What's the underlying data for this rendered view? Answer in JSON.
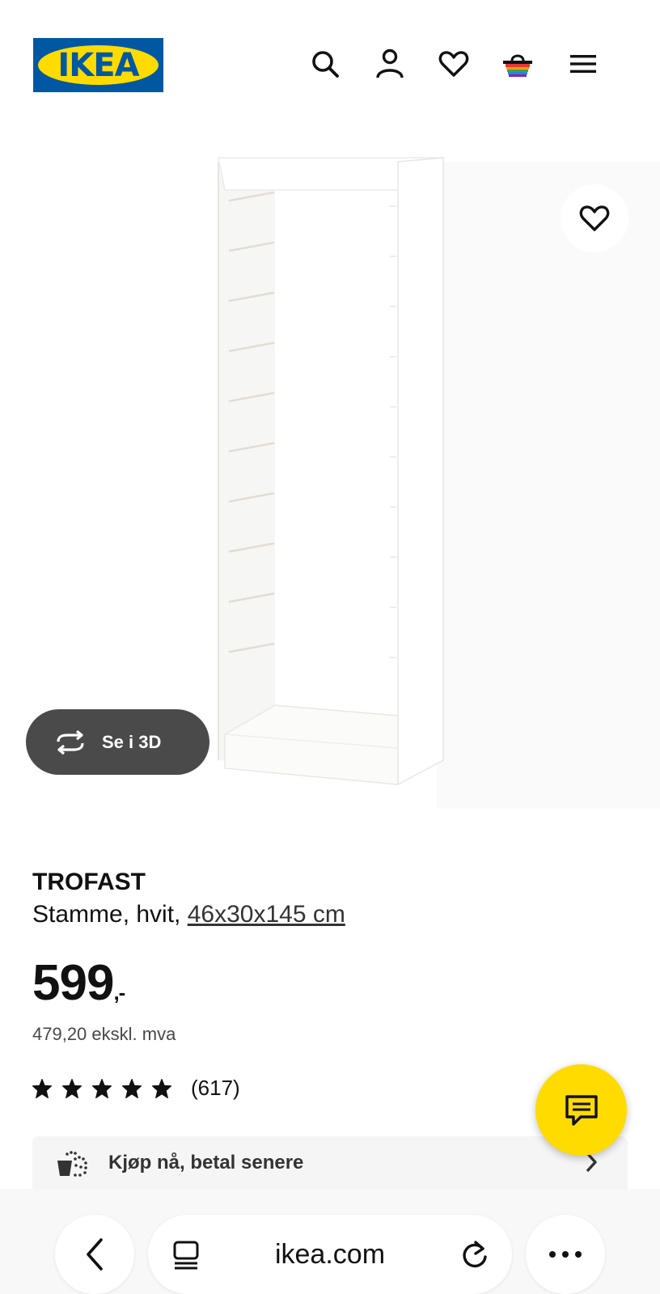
{
  "header": {
    "logo_text": "IKEA",
    "icons": [
      "search-icon",
      "account-icon",
      "favorites-icon",
      "basket-icon",
      "menu-icon"
    ]
  },
  "product": {
    "view_3d_label": "Se i 3D",
    "name": "TROFAST",
    "description": "Stamme, hvit, ",
    "dimensions": "46x30x145 cm",
    "price_main": "599",
    "price_suffix": ",-",
    "price_ex_vat": "479,20 ekskl. mva",
    "rating_stars": 5,
    "rating_max": 5,
    "rating_count": "(617)"
  },
  "paylater": {
    "label": "Kjøp nå, betal senere"
  },
  "browser": {
    "url": "ikea.com"
  },
  "colors": {
    "ikea_blue": "#0058a3",
    "ikea_yellow": "#ffdb00",
    "button_dark": "#4a4a4a"
  }
}
